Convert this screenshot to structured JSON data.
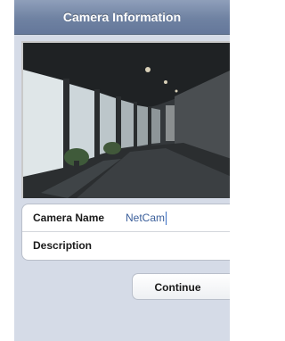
{
  "navbar": {
    "title": "Camera Information"
  },
  "form": {
    "camera_name_label": "Camera Name",
    "camera_name_value": "NetCam",
    "description_label": "Description",
    "description_value": ""
  },
  "actions": {
    "continue_label": "Continue"
  },
  "colors": {
    "navbar": "#6f82a2",
    "background": "#d5dbe7",
    "value_text": "#3a5e9a"
  }
}
